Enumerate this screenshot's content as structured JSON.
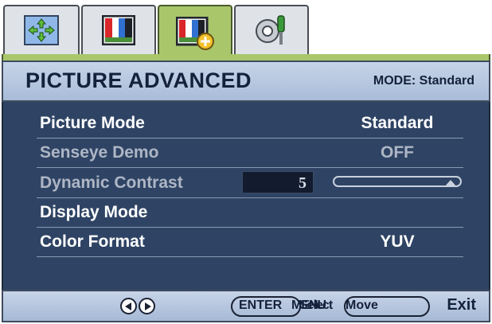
{
  "tabs": [
    {
      "icon": "move-arrows-icon",
      "active": false
    },
    {
      "icon": "color-bars-icon",
      "active": false
    },
    {
      "icon": "color-bars-plus-icon",
      "active": true
    },
    {
      "icon": "gear-screwdriver-icon",
      "active": false
    }
  ],
  "header": {
    "title": "PICTURE ADVANCED",
    "mode": "MODE: Standard"
  },
  "menu": [
    {
      "label": "Picture Mode",
      "value": "Standard",
      "enabled": true
    },
    {
      "label": "Senseye Demo",
      "value": "OFF",
      "enabled": false
    },
    {
      "label": "Dynamic Contrast",
      "value": "5",
      "enabled": false,
      "slider_fraction": 1.0
    },
    {
      "label": "Display Mode",
      "value": "",
      "enabled": true
    },
    {
      "label": "Color Format",
      "value": "YUV",
      "enabled": true
    }
  ],
  "footer": {
    "enter": "ENTER",
    "menu": "MENU",
    "select": "Select",
    "move": "Move",
    "exit": "Exit"
  },
  "colors": {
    "accent": "#a9c66b",
    "panel": "#2f4464",
    "header": "#b7c8e2"
  }
}
